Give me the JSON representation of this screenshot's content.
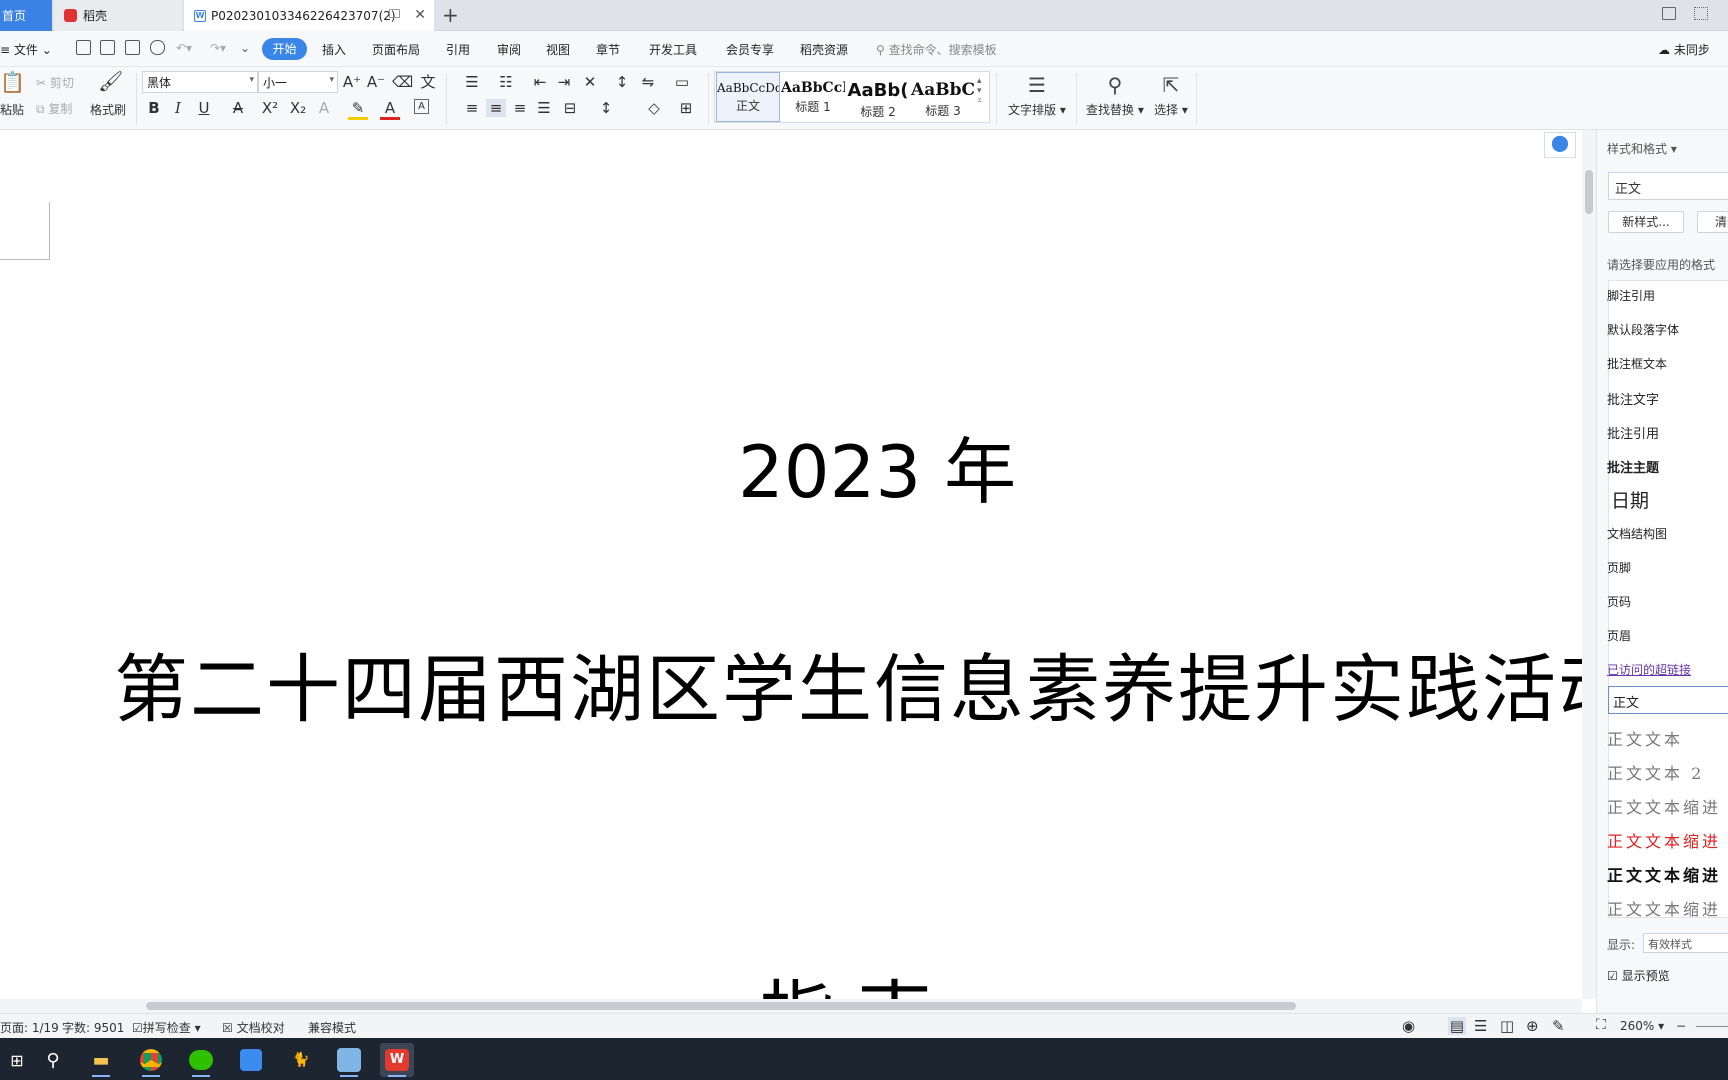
{
  "tabs": {
    "home": "首页",
    "daoke": "稻壳",
    "doc": "P020230103346226423707(2)"
  },
  "menu": {
    "file": "文件",
    "items": [
      "开始",
      "插入",
      "页面布局",
      "引用",
      "审阅",
      "视图",
      "章节",
      "开发工具",
      "会员专享",
      "稻壳资源"
    ],
    "search": "查找命令、搜索模板",
    "sync": "未同步"
  },
  "ribbon": {
    "paste": "粘贴",
    "cut": "剪切",
    "copy": "复制",
    "format_painter": "格式刷",
    "font": "黑体",
    "size": "小一",
    "styles": [
      {
        "preview": "AaBbCcDd",
        "name": "正文"
      },
      {
        "preview": "AaBbCcI",
        "name": "标题 1"
      },
      {
        "preview": "AaBb(",
        "name": "标题 2"
      },
      {
        "preview": "AaBbC",
        "name": "标题 3"
      }
    ],
    "text_layout": "文字排版",
    "find_replace": "查找替换",
    "select": "选择"
  },
  "document": {
    "year": "2023 年",
    "title": "第二十四届西湖区学生信息素养提升实践活动",
    "partial": "指  南"
  },
  "pane": {
    "title": "样式和格式",
    "current": "正文",
    "new_style": "新样式...",
    "clear": "清除",
    "prompt": "请选择要应用的格式",
    "styles": [
      "脚注引用",
      "默认段落字体",
      "批注框文本",
      "批注文字",
      "批注引用",
      "批注主题",
      "日期",
      "文档结构图",
      "页脚",
      "页码",
      "页眉",
      "已访问的超链接",
      "正文",
      "正文文本",
      "正文文本 2",
      "正文文本缩进",
      "正文文本缩进",
      "正文文本缩进",
      "正文文本缩进"
    ],
    "show_label": "显示:",
    "show_value": "有效样式",
    "preview": "显示预览"
  },
  "status": {
    "page": "页面: 1/19",
    "words": "字数: 9501",
    "spell": "拼写检查",
    "proof": "文档校对",
    "compat": "兼容模式",
    "zoom": "260%"
  }
}
